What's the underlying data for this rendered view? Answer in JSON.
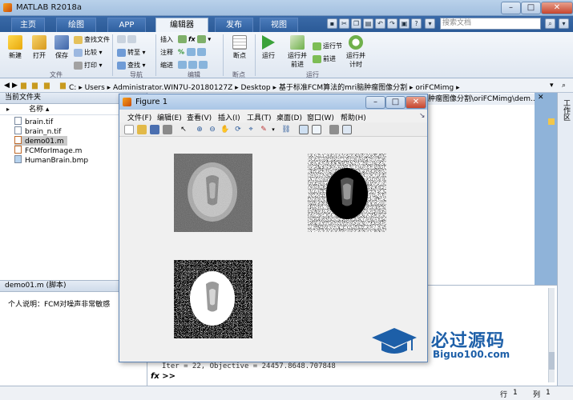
{
  "app": {
    "title": "MATLAB R2018a",
    "search_placeholder": "搜索文档"
  },
  "tabs": [
    "主页",
    "绘图",
    "APP",
    "编辑器",
    "发布",
    "视图"
  ],
  "ribbon": {
    "file_group": {
      "new": "新建",
      "open": "打开",
      "save": "保存",
      "find_files": "查找文件",
      "compare": "比较",
      "print": "打印",
      "section": "文件"
    },
    "nav_group": {
      "goto": "转至",
      "find": "查找",
      "section": "导航"
    },
    "edit_group": {
      "insert": "插入",
      "comment": "注释",
      "indent": "缩进",
      "fx": "fx",
      "section": "编辑"
    },
    "breakpoints_group": {
      "breakpoints": "断点",
      "section": "断点"
    },
    "run_group": {
      "run": "运行",
      "run_advance": "运行并前进",
      "run_section": "运行节",
      "advance": "前进",
      "run_time": "运行并计时",
      "section": "运行"
    }
  },
  "path": {
    "segments": [
      "C:",
      "Users",
      "Administrator.WIN7U-20180127Z",
      "Desktop",
      "基于标准FCM算法的mri脑肿瘤图像分割",
      "oriFCMimg"
    ],
    "editor_path_tail": "肿瘤图像分割\\oriFCMimg\\dem..."
  },
  "folder_panel": {
    "title": "当前文件夹",
    "column": "名称",
    "files": [
      {
        "name": "brain.tif",
        "type": "tif"
      },
      {
        "name": "brain_n.tif",
        "type": "tif"
      },
      {
        "name": "demo01.m",
        "type": "m",
        "selected": true
      },
      {
        "name": "FCMforImage.m",
        "type": "m"
      },
      {
        "name": "HumanBrain.bmp",
        "type": "bmp"
      }
    ]
  },
  "details": {
    "title": "demo01.m (脚本)",
    "description": "个人说明：FCM对噪声非常敏感"
  },
  "right_strip_label": "工作区",
  "command_window": {
    "last_line": "Iter = 22, Objective = 24457.8648.707848",
    "prompt": "fx >>"
  },
  "status": {
    "line_label": "行",
    "line": "1",
    "col_label": "列",
    "col": "1"
  },
  "figure": {
    "title": "Figure 1",
    "menus": [
      "文件(F)",
      "编辑(E)",
      "查看(V)",
      "插入(I)",
      "工具(T)",
      "桌面(D)",
      "窗口(W)",
      "帮助(H)"
    ]
  },
  "watermark": {
    "title": "必过源码",
    "url": "Biguo100.com"
  }
}
